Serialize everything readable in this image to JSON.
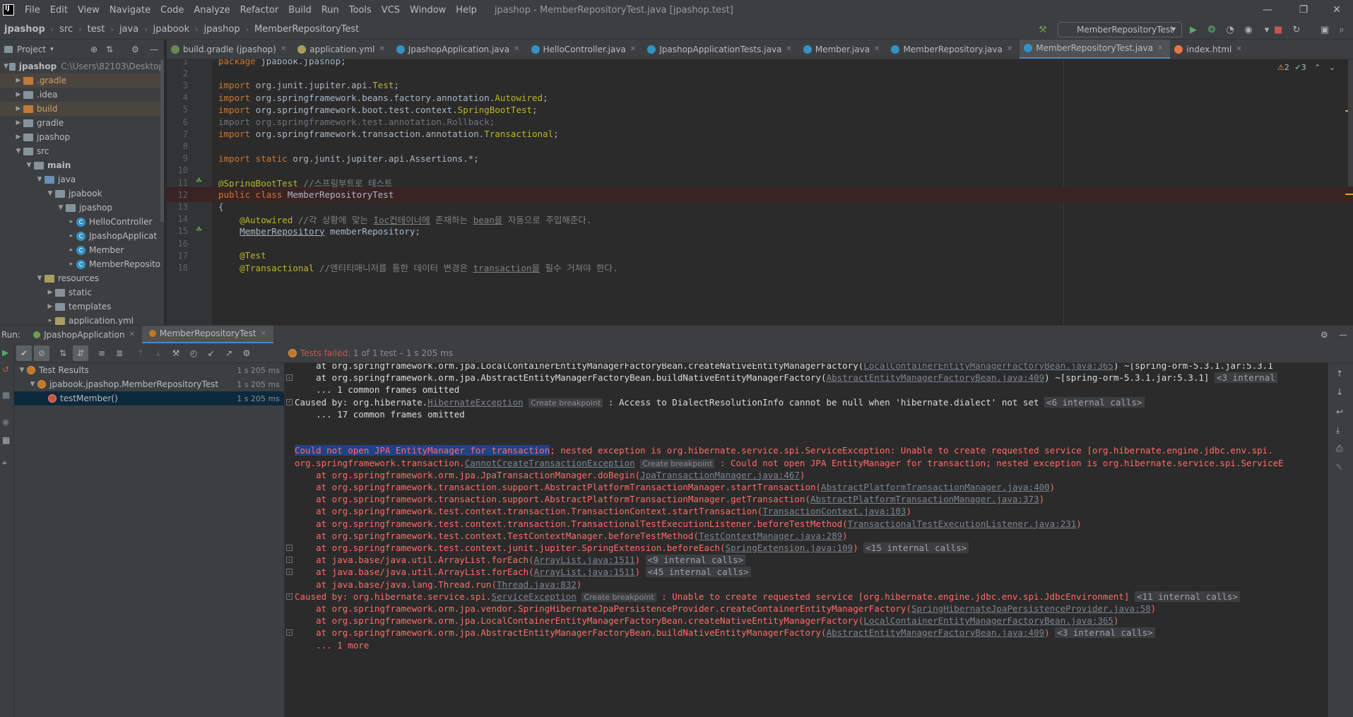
{
  "menu": {
    "items": [
      "File",
      "Edit",
      "View",
      "Navigate",
      "Code",
      "Analyze",
      "Refactor",
      "Build",
      "Run",
      "Tools",
      "VCS",
      "Window",
      "Help"
    ],
    "window_title": "jpashop - MemberRepositoryTest.java [jpashop.test]"
  },
  "nav": {
    "crumbs": [
      "jpashop",
      "src",
      "test",
      "java",
      "jpabook",
      "jpashop",
      "MemberRepositoryTest"
    ],
    "run_config": "MemberRepositoryTest"
  },
  "project": {
    "header": "Project",
    "root_name": "jpashop",
    "root_path": "C:\\Users\\82103\\Desktop",
    "items": [
      {
        "label": ".gradle",
        "depth": 1,
        "icon": "folder-orange",
        "hl": true
      },
      {
        "label": ".idea",
        "depth": 1,
        "icon": "folder",
        "hl": false
      },
      {
        "label": "build",
        "depth": 1,
        "icon": "folder-orange",
        "hl": true
      },
      {
        "label": "gradle",
        "depth": 1,
        "icon": "folder",
        "hl": false
      },
      {
        "label": "jpashop",
        "depth": 1,
        "icon": "folder",
        "hl": false
      },
      {
        "label": "src",
        "depth": 1,
        "icon": "folder",
        "hl": false,
        "open": true
      },
      {
        "label": "main",
        "depth": 2,
        "icon": "folder",
        "hl": false,
        "open": true,
        "bold": true
      },
      {
        "label": "java",
        "depth": 3,
        "icon": "folder-blue",
        "hl": false,
        "open": true
      },
      {
        "label": "jpabook",
        "depth": 4,
        "icon": "folder",
        "hl": false,
        "open": true
      },
      {
        "label": "jpashop",
        "depth": 5,
        "icon": "folder",
        "hl": false,
        "open": true
      },
      {
        "label": "HelloController",
        "depth": 6,
        "icon": "class",
        "hl": false
      },
      {
        "label": "JpashopApplicat",
        "depth": 6,
        "icon": "class",
        "hl": false
      },
      {
        "label": "Member",
        "depth": 6,
        "icon": "class",
        "hl": false
      },
      {
        "label": "MemberReposito",
        "depth": 6,
        "icon": "class",
        "hl": false
      },
      {
        "label": "resources",
        "depth": 3,
        "icon": "folder-res",
        "hl": false,
        "open": true
      },
      {
        "label": "static",
        "depth": 4,
        "icon": "folder",
        "hl": false
      },
      {
        "label": "templates",
        "depth": 4,
        "icon": "folder",
        "hl": false
      },
      {
        "label": "application.yml",
        "depth": 4,
        "icon": "file",
        "hl": false
      }
    ]
  },
  "editor_tabs": [
    {
      "label": "build.gradle (jpashop)",
      "color": "#6a8759",
      "active": false
    },
    {
      "label": "application.yml",
      "color": "#a89f5e",
      "active": false
    },
    {
      "label": "JpashopApplication.java",
      "color": "#3592c4",
      "active": false
    },
    {
      "label": "HelloController.java",
      "color": "#3592c4",
      "active": false
    },
    {
      "label": "JpashopApplicationTests.java",
      "color": "#3592c4",
      "active": false
    },
    {
      "label": "Member.java",
      "color": "#3592c4",
      "active": false
    },
    {
      "label": "MemberRepository.java",
      "color": "#3592c4",
      "active": false
    },
    {
      "label": "MemberRepositoryTest.java",
      "color": "#3592c4",
      "active": true
    },
    {
      "label": "index.html",
      "color": "#e8754a",
      "active": false
    }
  ],
  "inspections": {
    "warnings": "2",
    "ok": "3"
  },
  "code_lines": [
    {
      "n": "1",
      "html": "<span class='kw'>package</span> <span class='pl'>jpabook.jpashop;</span>"
    },
    {
      "n": "2",
      "html": ""
    },
    {
      "n": "3",
      "html": "<span class='kw'>import</span> <span class='pl'>org.junit.jupiter.api.</span><span class='ann'>Test</span><span class='pl'>;</span>"
    },
    {
      "n": "4",
      "html": "<span class='kw'>import</span> <span class='pl'>org.springframework.beans.factory.annotation.</span><span class='ann'>Autowired</span><span class='pl'>;</span>"
    },
    {
      "n": "5",
      "html": "<span class='kw'>import</span> <span class='pl'>org.springframework.boot.test.context.</span><span class='ann'>SpringBootTest</span><span class='pl'>;</span>"
    },
    {
      "n": "6",
      "html": "<span class='dim'>import org.springframework.test.annotation.Rollback;</span>"
    },
    {
      "n": "7",
      "html": "<span class='kw'>import</span> <span class='pl'>org.springframework.transaction.annotation.</span><span class='ann'>Transactional</span><span class='pl'>;</span>"
    },
    {
      "n": "8",
      "html": ""
    },
    {
      "n": "9",
      "html": "<span class='kw'>import static</span> <span class='pl'>org.junit.jupiter.api.Assertions.*;</span>"
    },
    {
      "n": "10",
      "html": ""
    },
    {
      "n": "11",
      "html": "<span class='ann'>@SpringBootTest</span> <span class='cmt'>//스프링부트로 테스트</span>"
    },
    {
      "n": "12",
      "html": "<span class='kw'>public class</span> <span class='pl'>MemberRepositoryTest</span>",
      "err": true
    },
    {
      "n": "13",
      "html": "<span class='pl'>{</span>"
    },
    {
      "n": "14",
      "html": "    <span class='ann'>@Autowired</span> <span class='cmt'>//각 상황에 맞는 <span class='ul'>Ioc컨테이너에</span> 존재하는 <span class='ul'>bean을</span> 자동으로 주입해준다.</span>"
    },
    {
      "n": "15",
      "html": "    <span class='pl ul'>MemberRepository</span> <span class='pl'>memberRepository;</span>"
    },
    {
      "n": "16",
      "html": ""
    },
    {
      "n": "17",
      "html": "    <span class='ann'>@Test</span>"
    },
    {
      "n": "18",
      "html": "    <span class='ann'>@Transactional</span> <span class='cmt'>//엔티티매니저를 통한 데이터 변경은 <span class='ul'>transaction을</span> 필수 거쳐야 한다.</span>"
    }
  ],
  "run": {
    "label": "Run:",
    "tabs": [
      {
        "label": "JpashopApplication",
        "active": false
      },
      {
        "label": "MemberRepositoryTest",
        "active": true
      }
    ],
    "status_label": "Tests failed:",
    "status_detail": "1 of 1 test – 1 s 205 ms",
    "tree": [
      {
        "label": "Test Results",
        "time": "1 s 205 ms",
        "depth": 0
      },
      {
        "label": "jpabook.jpashop.MemberRepositoryTest",
        "time": "1 s 205 ms",
        "depth": 1
      },
      {
        "label": "testMember()",
        "time": "1 s 205 ms",
        "depth": 2,
        "selected": true
      }
    ]
  },
  "console_lines": [
    {
      "fold": false,
      "html": "    at org.springframework.orm.jpa.LocalContainerEntityManagerFactoryBean.createNativeEntityManagerFactory(<span class='link'>LocalContainerEntityManagerFactoryBean.java:365</span>) ~[spring-orm-5.3.1.jar:5.3.1"
    },
    {
      "fold": true,
      "html": "    at org.springframework.orm.jpa.AbstractEntityManagerFactoryBean.buildNativeEntityManagerFactory(<span class='link'>AbstractEntityManagerFactoryBean.java:409</span>) ~[spring-orm-5.3.1.jar:5.3.1] <span class='chip-dark'>&lt;3 internal</span>"
    },
    {
      "fold": false,
      "html": "    ... 1 common frames omitted"
    },
    {
      "fold": true,
      "html": "Caused by: org.hibernate.<span class='link'>HibernateException</span> <span class='chip'>Create breakpoint</span> : Access to DialectResolutionInfo cannot be null when 'hibernate.dialect' not set <span class='chip-dark'>&lt;6 internal calls&gt;</span>"
    },
    {
      "fold": false,
      "html": "    ... 17 common frames omitted"
    },
    {
      "fold": false,
      "html": ""
    },
    {
      "fold": false,
      "html": ""
    },
    {
      "fold": false,
      "html": "<span class='red'><span class='selected-text'>Could not open JPA EntityManager for transaction</span>; nested exception is org.hibernate.service.spi.ServiceException: Unable to create requested service [org.hibernate.engine.jdbc.env.spi.</span>"
    },
    {
      "fold": false,
      "html": "<span class='red'>org.springframework.transaction.<span class='link'>CannotCreateTransactionException</span> <span class='chip'>Create breakpoint</span> : Could not open JPA EntityManager for transaction; nested exception is org.hibernate.service.spi.ServiceE</span>"
    },
    {
      "fold": false,
      "html": "<span class='red'>    at org.springframework.orm.jpa.JpaTransactionManager.doBegin(<span class='link'>JpaTransactionManager.java:467</span>)</span>"
    },
    {
      "fold": false,
      "html": "<span class='red'>    at org.springframework.transaction.support.AbstractPlatformTransactionManager.startTransaction(<span class='link'>AbstractPlatformTransactionManager.java:400</span>)</span>"
    },
    {
      "fold": false,
      "html": "<span class='red'>    at org.springframework.transaction.support.AbstractPlatformTransactionManager.getTransaction(<span class='link'>AbstractPlatformTransactionManager.java:373</span>)</span>"
    },
    {
      "fold": false,
      "html": "<span class='red'>    at org.springframework.test.context.transaction.TransactionContext.startTransaction(<span class='link'>TransactionContext.java:103</span>)</span>"
    },
    {
      "fold": false,
      "html": "<span class='red'>    at org.springframework.test.context.transaction.TransactionalTestExecutionListener.beforeTestMethod(<span class='link'>TransactionalTestExecutionListener.java:231</span>)</span>"
    },
    {
      "fold": false,
      "html": "<span class='red'>    at org.springframework.test.context.TestContextManager.beforeTestMethod(<span class='link'>TestContextManager.java:289</span>)</span>"
    },
    {
      "fold": true,
      "html": "<span class='red'>    at org.springframework.test.context.junit.jupiter.SpringExtension.beforeEach(<span class='link'>SpringExtension.java:109</span>) <span class='chip-dark'>&lt;15 internal calls&gt;</span></span>"
    },
    {
      "fold": true,
      "html": "<span class='red'>    at java.base/java.util.ArrayList.forEach(<span class='link'>ArrayList.java:1511</span>) <span class='chip-dark'>&lt;9 internal calls&gt;</span></span>"
    },
    {
      "fold": true,
      "html": "<span class='red'>    at java.base/java.util.ArrayList.forEach(<span class='link'>ArrayList.java:1511</span>) <span class='chip-dark'>&lt;45 internal calls&gt;</span></span>"
    },
    {
      "fold": false,
      "html": "<span class='red'>    at java.base/java.lang.Thread.run(<span class='link'>Thread.java:832</span>)</span>"
    },
    {
      "fold": true,
      "html": "<span class='red'>Caused by: org.hibernate.service.spi.<span class='link'>ServiceException</span> <span class='chip'>Create breakpoint</span> : Unable to create requested service [org.hibernate.engine.jdbc.env.spi.JdbcEnvironment] <span class='chip-dark'>&lt;11 internal calls&gt;</span></span>"
    },
    {
      "fold": false,
      "html": "<span class='red'>    at org.springframework.orm.jpa.vendor.SpringHibernateJpaPersistenceProvider.createContainerEntityManagerFactory(<span class='link'>SpringHibernateJpaPersistenceProvider.java:58</span>)</span>"
    },
    {
      "fold": false,
      "html": "<span class='red'>    at org.springframework.orm.jpa.LocalContainerEntityManagerFactoryBean.createNativeEntityManagerFactory(<span class='link'>LocalContainerEntityManagerFactoryBean.java:365</span>)</span>"
    },
    {
      "fold": true,
      "html": "<span class='red'>    at org.springframework.orm.jpa.AbstractEntityManagerFactoryBean.buildNativeEntityManagerFactory(<span class='link'>AbstractEntityManagerFactoryBean.java:409</span>) <span class='chip-dark'>&lt;3 internal calls&gt;</span></span>"
    },
    {
      "fold": false,
      "html": "<span class='red'>    ... 1 more</span>"
    }
  ]
}
